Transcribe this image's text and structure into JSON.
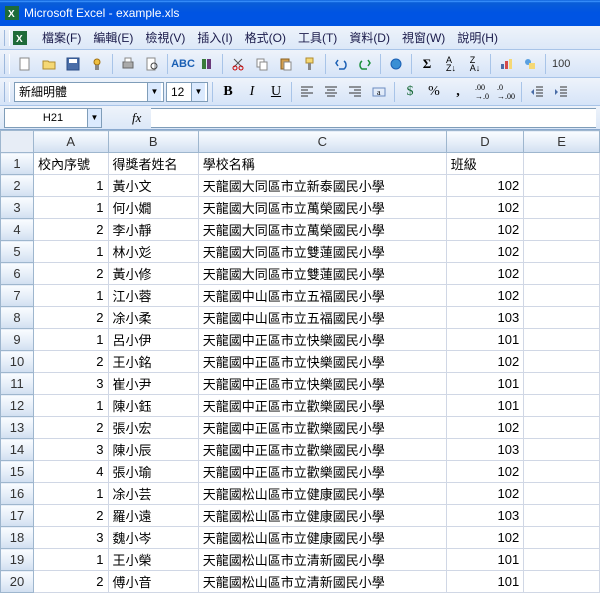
{
  "title": "Microsoft Excel - example.xls",
  "menus": {
    "file": "檔案(F)",
    "edit": "編輯(E)",
    "view": "檢視(V)",
    "insert": "插入(I)",
    "format": "格式(O)",
    "tools": "工具(T)",
    "data": "資料(D)",
    "window": "視窗(W)",
    "help": "說明(H)"
  },
  "toolbar": {
    "zoom": "100"
  },
  "format": {
    "font_name": "新細明體",
    "font_size": "12"
  },
  "name_box": "H21",
  "formula": "",
  "columns": [
    "A",
    "B",
    "C",
    "D",
    "E"
  ],
  "headers": {
    "A": "校內序號",
    "B": "得獎者姓名",
    "C": "學校名稱",
    "D": "班級"
  },
  "rows": [
    {
      "n": 1,
      "A": "1",
      "B": "黃小文",
      "C": "天龍國大同區市立新泰國民小學",
      "D": "102"
    },
    {
      "n": 2,
      "A": "1",
      "B": "何小嫺",
      "C": "天龍國大同區市立萬榮國民小學",
      "D": "102"
    },
    {
      "n": 3,
      "A": "2",
      "B": "李小靜",
      "C": "天龍國大同區市立萬榮國民小學",
      "D": "102"
    },
    {
      "n": 4,
      "A": "1",
      "B": "林小彣",
      "C": "天龍國大同區市立雙蓮國民小學",
      "D": "102"
    },
    {
      "n": 5,
      "A": "2",
      "B": "黃小修",
      "C": "天龍國大同區市立雙蓮國民小學",
      "D": "102"
    },
    {
      "n": 6,
      "A": "1",
      "B": "江小蓉",
      "C": "天龍國中山區市立五福國民小學",
      "D": "102"
    },
    {
      "n": 7,
      "A": "2",
      "B": "凃小柔",
      "C": "天龍國中山區市立五福國民小學",
      "D": "103"
    },
    {
      "n": 8,
      "A": "1",
      "B": "呂小伊",
      "C": "天龍國中正區市立快樂國民小學",
      "D": "101"
    },
    {
      "n": 9,
      "A": "2",
      "B": "王小銘",
      "C": "天龍國中正區市立快樂國民小學",
      "D": "102"
    },
    {
      "n": 10,
      "A": "3",
      "B": "崔小尹",
      "C": "天龍國中正區市立快樂國民小學",
      "D": "101"
    },
    {
      "n": 11,
      "A": "1",
      "B": "陳小鈺",
      "C": "天龍國中正區市立歡樂國民小學",
      "D": "101"
    },
    {
      "n": 12,
      "A": "2",
      "B": "張小宏",
      "C": "天龍國中正區市立歡樂國民小學",
      "D": "102"
    },
    {
      "n": 13,
      "A": "3",
      "B": "陳小辰",
      "C": "天龍國中正區市立歡樂國民小學",
      "D": "103"
    },
    {
      "n": 14,
      "A": "4",
      "B": "張小瑜",
      "C": "天龍國中正區市立歡樂國民小學",
      "D": "102"
    },
    {
      "n": 15,
      "A": "1",
      "B": "凃小芸",
      "C": "天龍國松山區市立健康國民小學",
      "D": "102"
    },
    {
      "n": 16,
      "A": "2",
      "B": "羅小遠",
      "C": "天龍國松山區市立健康國民小學",
      "D": "103"
    },
    {
      "n": 17,
      "A": "3",
      "B": "魏小岑",
      "C": "天龍國松山區市立健康國民小學",
      "D": "102"
    },
    {
      "n": 18,
      "A": "1",
      "B": "王小榮",
      "C": "天龍國松山區市立清新國民小學",
      "D": "101"
    },
    {
      "n": 19,
      "A": "2",
      "B": "傅小音",
      "C": "天龍國松山區市立清新國民小學",
      "D": "101"
    }
  ]
}
